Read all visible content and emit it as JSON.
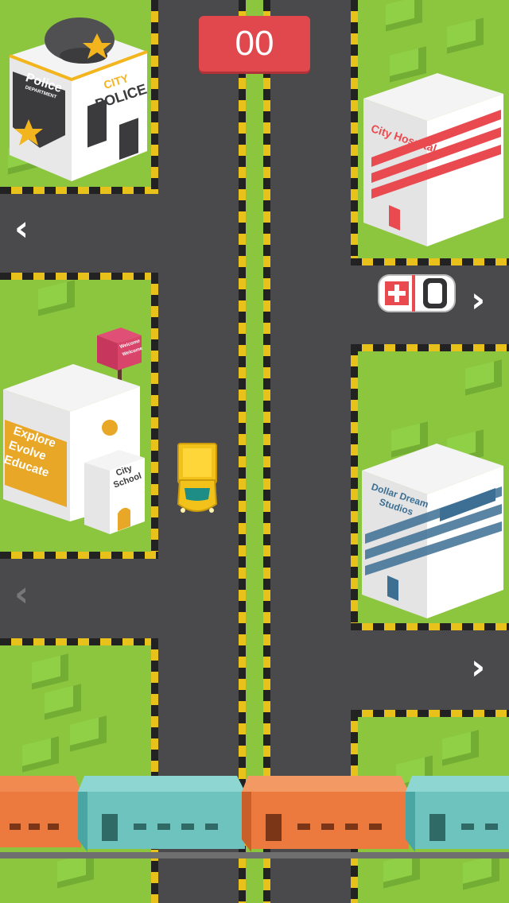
{
  "hud": {
    "score": "00"
  },
  "buildings": {
    "police": {
      "badge_line1": "Police",
      "badge_line2": "DEPARTMENT",
      "roof_sign_line1": "CITY",
      "roof_sign_line2": "POLICE"
    },
    "hospital": {
      "sign": "City Hospital"
    },
    "school": {
      "mural_line1": "Explore",
      "mural_line2": "Evolve",
      "mural_line3": "Educate",
      "sign_line1": "City",
      "sign_line2": "School",
      "billboard_line1": "Welcome",
      "billboard_line2": "Welcome"
    },
    "studio": {
      "sign_line1": "Dollar Dream",
      "sign_line2": "Studios"
    }
  },
  "controls": {
    "lane1_arrow": "‹",
    "lane2_arrow": "›",
    "lane3_arrow": "‹",
    "lane4_arrow": "›"
  },
  "colors": {
    "grass": "#8cc63f",
    "road": "#4a4a4c",
    "score_badge": "#e0484d",
    "player_car": "#f2c21b",
    "train_orange": "#ec7a3e",
    "train_teal": "#6fc3bf"
  }
}
